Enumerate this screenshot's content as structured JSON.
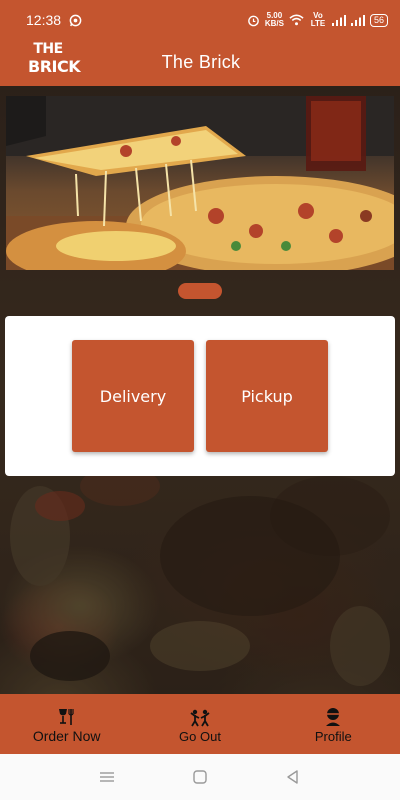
{
  "status_bar": {
    "time": "12:38",
    "whatsapp_icon": "whatsapp-icon",
    "net_speed_value": "5.00",
    "net_speed_unit": "KB/S",
    "volte_label": "Vo LTE",
    "battery": "56"
  },
  "app_bar": {
    "logo_line1": "THE",
    "logo_line2": "BRICK",
    "title": "The Brick"
  },
  "options": {
    "delivery_label": "Delivery",
    "pickup_label": "Pickup"
  },
  "bottom_nav": {
    "items": [
      {
        "label": "Order Now",
        "icon": "dining-icon"
      },
      {
        "label": "Go Out",
        "icon": "people-icon"
      },
      {
        "label": "Profile",
        "icon": "profile-icon"
      }
    ]
  },
  "system_nav": {
    "icons": [
      "menu-icon",
      "home-icon",
      "back-icon"
    ]
  },
  "colors": {
    "brand": "#c4552f",
    "card": "#ffffff"
  }
}
